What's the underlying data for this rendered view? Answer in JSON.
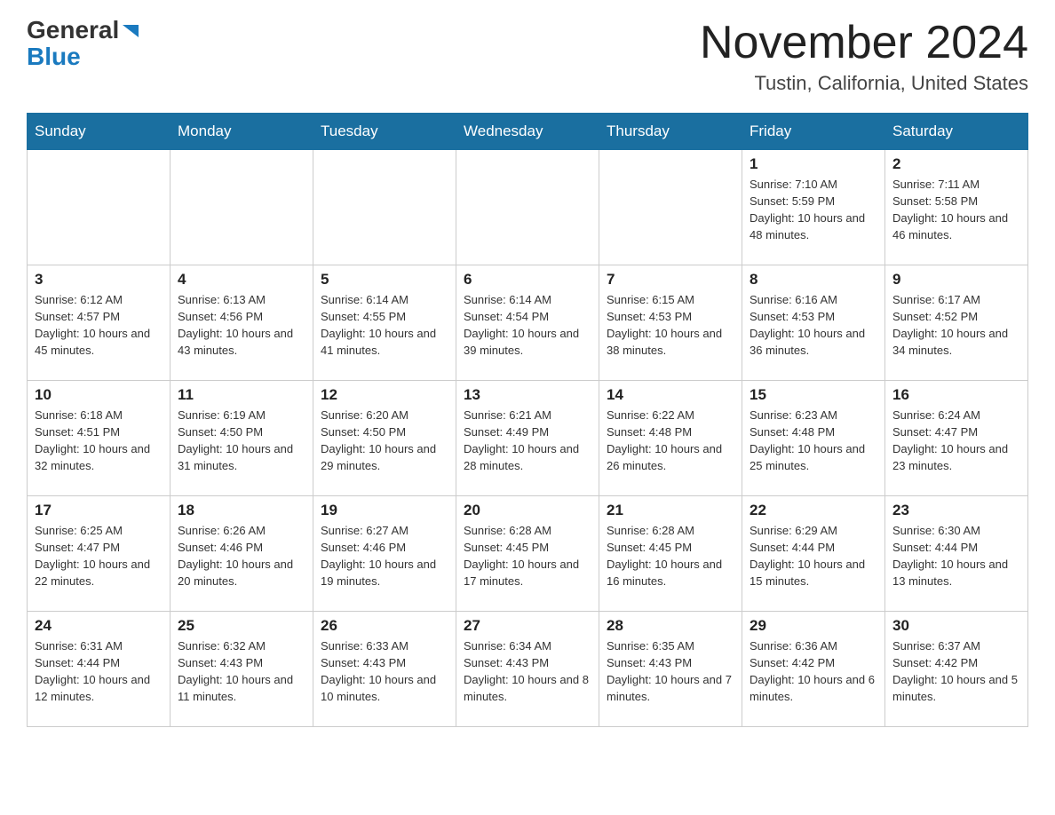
{
  "logo": {
    "general": "General",
    "blue": "Blue"
  },
  "header": {
    "month": "November 2024",
    "location": "Tustin, California, United States"
  },
  "weekdays": [
    "Sunday",
    "Monday",
    "Tuesday",
    "Wednesday",
    "Thursday",
    "Friday",
    "Saturday"
  ],
  "weeks": [
    [
      {
        "day": "",
        "info": ""
      },
      {
        "day": "",
        "info": ""
      },
      {
        "day": "",
        "info": ""
      },
      {
        "day": "",
        "info": ""
      },
      {
        "day": "",
        "info": ""
      },
      {
        "day": "1",
        "info": "Sunrise: 7:10 AM\nSunset: 5:59 PM\nDaylight: 10 hours and 48 minutes."
      },
      {
        "day": "2",
        "info": "Sunrise: 7:11 AM\nSunset: 5:58 PM\nDaylight: 10 hours and 46 minutes."
      }
    ],
    [
      {
        "day": "3",
        "info": "Sunrise: 6:12 AM\nSunset: 4:57 PM\nDaylight: 10 hours and 45 minutes."
      },
      {
        "day": "4",
        "info": "Sunrise: 6:13 AM\nSunset: 4:56 PM\nDaylight: 10 hours and 43 minutes."
      },
      {
        "day": "5",
        "info": "Sunrise: 6:14 AM\nSunset: 4:55 PM\nDaylight: 10 hours and 41 minutes."
      },
      {
        "day": "6",
        "info": "Sunrise: 6:14 AM\nSunset: 4:54 PM\nDaylight: 10 hours and 39 minutes."
      },
      {
        "day": "7",
        "info": "Sunrise: 6:15 AM\nSunset: 4:53 PM\nDaylight: 10 hours and 38 minutes."
      },
      {
        "day": "8",
        "info": "Sunrise: 6:16 AM\nSunset: 4:53 PM\nDaylight: 10 hours and 36 minutes."
      },
      {
        "day": "9",
        "info": "Sunrise: 6:17 AM\nSunset: 4:52 PM\nDaylight: 10 hours and 34 minutes."
      }
    ],
    [
      {
        "day": "10",
        "info": "Sunrise: 6:18 AM\nSunset: 4:51 PM\nDaylight: 10 hours and 32 minutes."
      },
      {
        "day": "11",
        "info": "Sunrise: 6:19 AM\nSunset: 4:50 PM\nDaylight: 10 hours and 31 minutes."
      },
      {
        "day": "12",
        "info": "Sunrise: 6:20 AM\nSunset: 4:50 PM\nDaylight: 10 hours and 29 minutes."
      },
      {
        "day": "13",
        "info": "Sunrise: 6:21 AM\nSunset: 4:49 PM\nDaylight: 10 hours and 28 minutes."
      },
      {
        "day": "14",
        "info": "Sunrise: 6:22 AM\nSunset: 4:48 PM\nDaylight: 10 hours and 26 minutes."
      },
      {
        "day": "15",
        "info": "Sunrise: 6:23 AM\nSunset: 4:48 PM\nDaylight: 10 hours and 25 minutes."
      },
      {
        "day": "16",
        "info": "Sunrise: 6:24 AM\nSunset: 4:47 PM\nDaylight: 10 hours and 23 minutes."
      }
    ],
    [
      {
        "day": "17",
        "info": "Sunrise: 6:25 AM\nSunset: 4:47 PM\nDaylight: 10 hours and 22 minutes."
      },
      {
        "day": "18",
        "info": "Sunrise: 6:26 AM\nSunset: 4:46 PM\nDaylight: 10 hours and 20 minutes."
      },
      {
        "day": "19",
        "info": "Sunrise: 6:27 AM\nSunset: 4:46 PM\nDaylight: 10 hours and 19 minutes."
      },
      {
        "day": "20",
        "info": "Sunrise: 6:28 AM\nSunset: 4:45 PM\nDaylight: 10 hours and 17 minutes."
      },
      {
        "day": "21",
        "info": "Sunrise: 6:28 AM\nSunset: 4:45 PM\nDaylight: 10 hours and 16 minutes."
      },
      {
        "day": "22",
        "info": "Sunrise: 6:29 AM\nSunset: 4:44 PM\nDaylight: 10 hours and 15 minutes."
      },
      {
        "day": "23",
        "info": "Sunrise: 6:30 AM\nSunset: 4:44 PM\nDaylight: 10 hours and 13 minutes."
      }
    ],
    [
      {
        "day": "24",
        "info": "Sunrise: 6:31 AM\nSunset: 4:44 PM\nDaylight: 10 hours and 12 minutes."
      },
      {
        "day": "25",
        "info": "Sunrise: 6:32 AM\nSunset: 4:43 PM\nDaylight: 10 hours and 11 minutes."
      },
      {
        "day": "26",
        "info": "Sunrise: 6:33 AM\nSunset: 4:43 PM\nDaylight: 10 hours and 10 minutes."
      },
      {
        "day": "27",
        "info": "Sunrise: 6:34 AM\nSunset: 4:43 PM\nDaylight: 10 hours and 8 minutes."
      },
      {
        "day": "28",
        "info": "Sunrise: 6:35 AM\nSunset: 4:43 PM\nDaylight: 10 hours and 7 minutes."
      },
      {
        "day": "29",
        "info": "Sunrise: 6:36 AM\nSunset: 4:42 PM\nDaylight: 10 hours and 6 minutes."
      },
      {
        "day": "30",
        "info": "Sunrise: 6:37 AM\nSunset: 4:42 PM\nDaylight: 10 hours and 5 minutes."
      }
    ]
  ]
}
